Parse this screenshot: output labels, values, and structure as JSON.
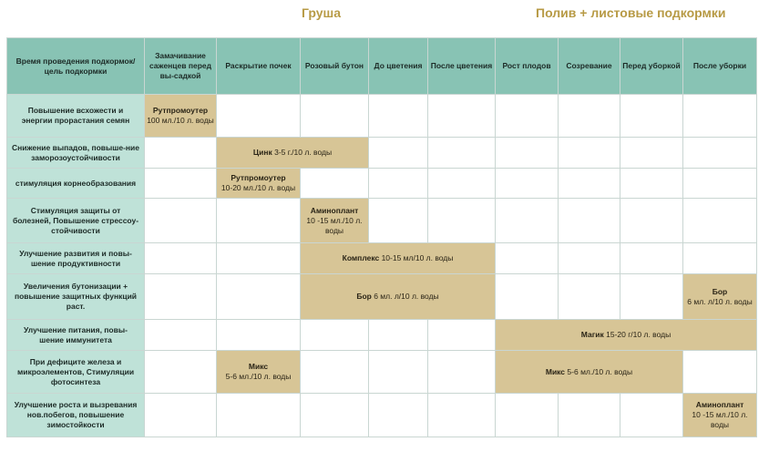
{
  "titles": {
    "main": "Груша",
    "sub": "Полив + листовые подкормки"
  },
  "columns": {
    "goal_header": "Время проведения подкормок/ цель подкормки",
    "stages": [
      "Замачивание саженцев перед вы-садкой",
      "Раскрытие почек",
      "Розовый бутон",
      "До цветения",
      "После цветения",
      "Рост плодов",
      "Созревание",
      "Перед уборкой",
      "После уборки"
    ]
  },
  "rows": [
    {
      "goal": "Повышение всхожести и энергии прорастания семян",
      "cells": [
        {
          "product": "Рутпромоутер",
          "dose": "100 мл./10 л. воды",
          "span": 1
        },
        {
          "empty": true,
          "span": 8
        }
      ]
    },
    {
      "goal": "Снижение выпадов, повыше-ние заморозоустойчивости",
      "cells": [
        {
          "empty": true,
          "span": 1
        },
        {
          "product": "Цинк",
          "dose": "3-5 г./10 л. воды",
          "span": 2
        },
        {
          "empty": true,
          "span": 6
        }
      ]
    },
    {
      "goal": "стимуляция корнеобразования",
      "cells": [
        {
          "empty": true,
          "span": 1
        },
        {
          "product": "Рутпромоутер",
          "dose": "10-20 мл./10 л. воды",
          "span": 1
        },
        {
          "empty": true,
          "span": 7
        }
      ]
    },
    {
      "goal": "Стимуляция защиты от болезней, Повышение стрессоу-стойчивости",
      "cells": [
        {
          "empty": true,
          "span": 2
        },
        {
          "product": "Аминоплант",
          "dose": "10 -15 мл./10 л. воды",
          "span": 1
        },
        {
          "empty": true,
          "span": 6
        }
      ]
    },
    {
      "goal": "Улучшение развития и повы-шение продуктивности",
      "cells": [
        {
          "empty": true,
          "span": 2
        },
        {
          "product": "Комплекс",
          "dose": "10-15 мл/10 л. воды",
          "span": 3
        },
        {
          "empty": true,
          "span": 4
        }
      ]
    },
    {
      "goal": "Увеличения бутонизации + повышение защитных функций раст.",
      "cells": [
        {
          "empty": true,
          "span": 2
        },
        {
          "product": "Бор",
          "dose": "6 мл. л/10 л. воды",
          "span": 3
        },
        {
          "empty": true,
          "span": 3
        },
        {
          "product": "Бор",
          "dose": "6 мл. л/10 л. воды",
          "span": 1
        }
      ]
    },
    {
      "goal": "Улучшение питания, повы-шение иммунитета",
      "cells": [
        {
          "empty": true,
          "span": 5
        },
        {
          "product": "Магик",
          "dose": "15-20 г/10 л. воды",
          "span": 4
        }
      ]
    },
    {
      "goal": "При дефиците железа и микроэлементов, Стимуляции фотосинтеза",
      "cells": [
        {
          "empty": true,
          "span": 1
        },
        {
          "product": "Микс",
          "dose": "5-6 мл./10 л. воды",
          "span": 1
        },
        {
          "empty": true,
          "span": 3
        },
        {
          "product": "Микс",
          "dose": "5-6 мл./10 л. воды",
          "span": 3
        },
        {
          "empty": true,
          "span": 1
        }
      ]
    },
    {
      "goal": "Улучшение роста и вызревания нов.побегов, повышение зимостойкости",
      "cells": [
        {
          "empty": true,
          "span": 8
        },
        {
          "product": "Аминоплант",
          "dose": "10 -15 мл./10 л. воды",
          "span": 1
        }
      ]
    }
  ],
  "colors": {
    "header_bg": "#88c3b4",
    "goal_bg": "#bfe2d8",
    "product_bg": "#d7c596",
    "title": "#b79a45"
  }
}
